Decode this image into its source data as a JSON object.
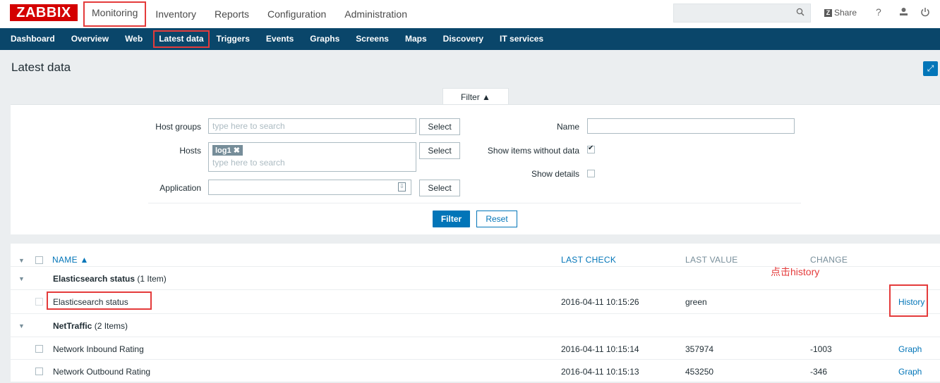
{
  "header": {
    "logo": "ZABBIX",
    "nav": [
      "Monitoring",
      "Inventory",
      "Reports",
      "Configuration",
      "Administration"
    ],
    "share": "Share",
    "help": "?",
    "icons": [
      "search-icon",
      "user-icon",
      "power-icon"
    ]
  },
  "subnav": [
    "Dashboard",
    "Overview",
    "Web",
    "Latest data",
    "Triggers",
    "Events",
    "Graphs",
    "Screens",
    "Maps",
    "Discovery",
    "IT services"
  ],
  "page": {
    "title": "Latest data"
  },
  "filter": {
    "tab": "Filter ▲",
    "host_groups_label": "Host groups",
    "host_groups_placeholder": "type here to search",
    "hosts_label": "Hosts",
    "hosts_tag": "log1",
    "hosts_placeholder": "type here to search",
    "application_label": "Application",
    "select": "Select",
    "name_label": "Name",
    "show_items_label": "Show items without data",
    "show_details_label": "Show details",
    "filter_button": "Filter",
    "reset_button": "Reset"
  },
  "table": {
    "columns": {
      "name": "NAME ▲",
      "last_check": "LAST CHECK",
      "last_value": "LAST VALUE",
      "change": "CHANGE"
    },
    "group1": {
      "name": "Elasticsearch status",
      "count": "(1 Item)"
    },
    "row1": {
      "name": "Elasticsearch status",
      "last_check": "2016-04-11 10:15:26",
      "last_value": "green",
      "change": "",
      "action": "History"
    },
    "group2": {
      "name": "NetTraffic",
      "count": "(2 Items)"
    },
    "row2": {
      "name": "Network Inbound Rating",
      "last_check": "2016-04-11 10:15:14",
      "last_value": "357974",
      "change": "-1003",
      "action": "Graph"
    },
    "row3": {
      "name": "Network Outbound Rating",
      "last_check": "2016-04-11 10:15:13",
      "last_value": "453250",
      "change": "-346",
      "action": "Graph"
    }
  },
  "annotation": "点击history"
}
